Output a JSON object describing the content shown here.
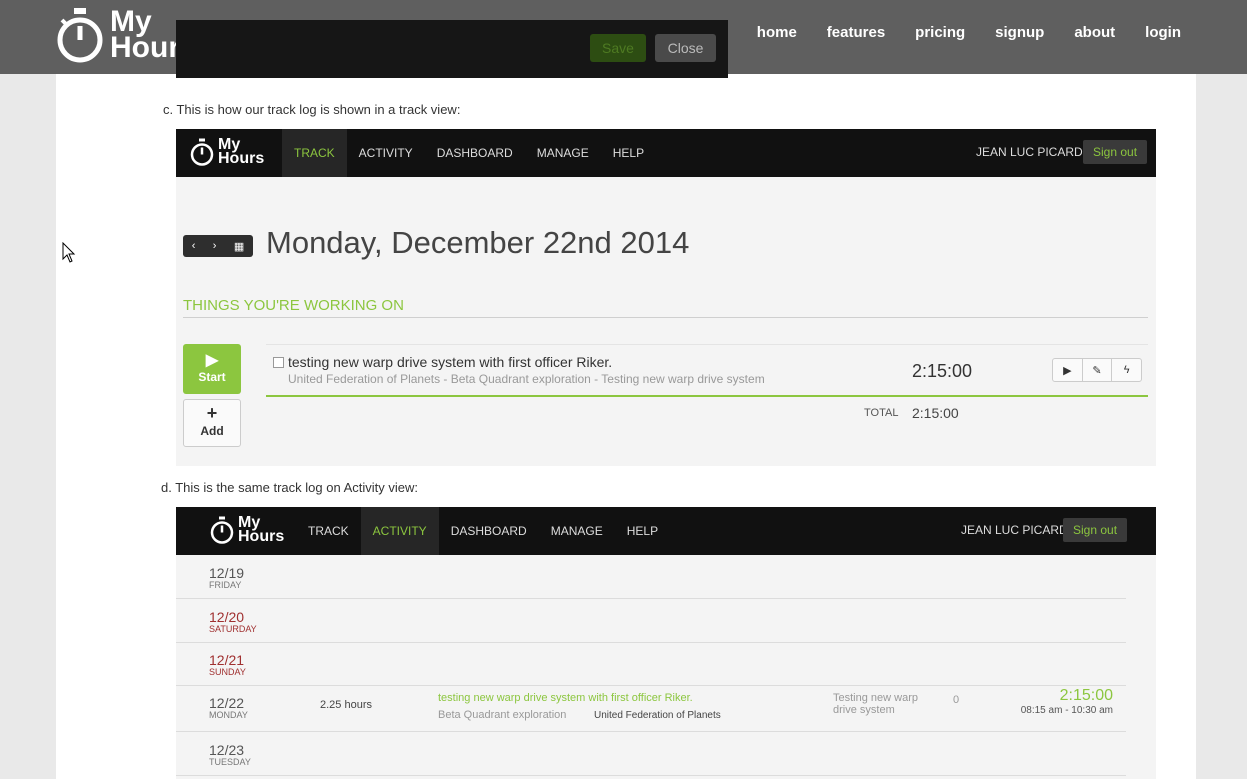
{
  "site": {
    "logo": {
      "line1": "My",
      "line2": "Hours"
    },
    "nav": [
      "home",
      "features",
      "pricing",
      "signup",
      "about",
      "login"
    ]
  },
  "dialog": {
    "save": "Save",
    "close": "Close"
  },
  "captions": {
    "c": "c. This is how our track log is shown in a track view:",
    "d": "d. This is the same track log on Activity view:"
  },
  "app": {
    "logo": {
      "line1": "My",
      "line2": "Hours"
    },
    "nav": [
      "TRACK",
      "ACTIVITY",
      "DASHBOARD",
      "MANAGE",
      "HELP"
    ],
    "user": "JEAN LUC PICARD",
    "signout": "Sign out"
  },
  "track_view": {
    "active_tab": "TRACK",
    "date": "Monday, December 22nd 2014",
    "date_nav": {
      "prev": "‹",
      "next": "›",
      "calendar": "▦"
    },
    "section": "THINGS YOU'RE WORKING ON",
    "start": "Start",
    "add": "Add",
    "entry": {
      "title": "testing new warp drive system with first officer Riker.",
      "subtitle": "United Federation of Planets - Beta Quadrant exploration - Testing new warp drive system",
      "time": "2:15:00"
    },
    "total_label": "TOTAL",
    "total_value": "2:15:00"
  },
  "activity_view": {
    "active_tab": "ACTIVITY",
    "days": [
      {
        "date": "12/19",
        "day": "FRIDAY",
        "weekend": false
      },
      {
        "date": "12/20",
        "day": "SATURDAY",
        "weekend": true
      },
      {
        "date": "12/21",
        "day": "SUNDAY",
        "weekend": true
      },
      {
        "date": "12/22",
        "day": "MONDAY",
        "weekend": false,
        "hours": "2.25 hours",
        "task": "testing new warp drive system with first officer Riker.",
        "project": "Beta Quadrant exploration",
        "client": "United Federation of Planets",
        "notes": "Testing new warp drive system",
        "count": "0",
        "time": "2:15:00",
        "range": "08:15 am - 10:30 am"
      },
      {
        "date": "12/23",
        "day": "TUESDAY",
        "weekend": false
      }
    ]
  },
  "colors": {
    "accent_green": "#8cc63f",
    "header_gray": "#5f5f5f",
    "app_bar": "#111111",
    "weekend_red": "#a03030"
  }
}
